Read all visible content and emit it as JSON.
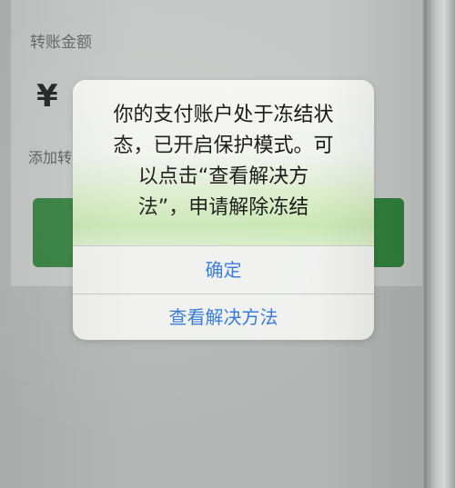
{
  "background_form": {
    "amount_label": "转账金额",
    "currency_symbol": "¥",
    "add_note": "添加转"
  },
  "alert": {
    "message_lines": [
      "你的支付账户处于冻结状",
      "态，已开启保护模式。可",
      "以点击“查看解决方",
      "法”，申请解除冻结"
    ],
    "confirm_label": "确定",
    "view_solution_label": "查看解决方法"
  },
  "colors": {
    "button_green": "#2c8a3a",
    "link_blue": "#2f76d8"
  }
}
